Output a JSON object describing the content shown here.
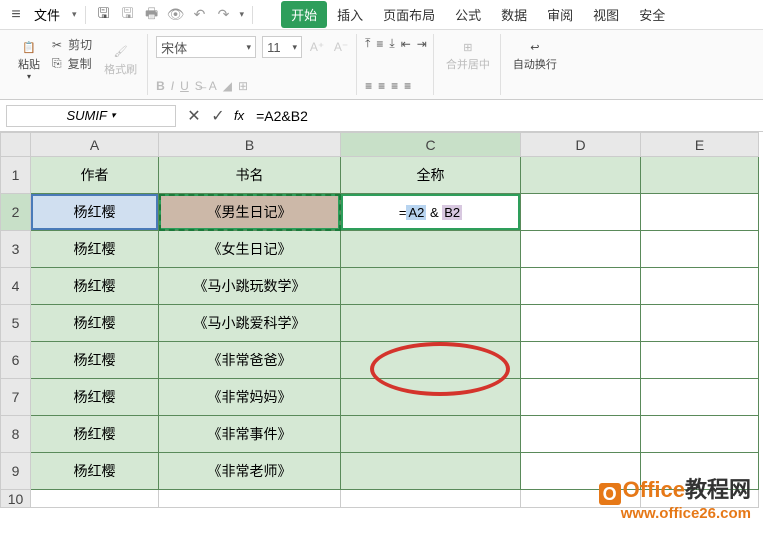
{
  "menu": {
    "file": "文件",
    "tabs": [
      "开始",
      "插入",
      "页面布局",
      "公式",
      "数据",
      "审阅",
      "视图",
      "安全"
    ]
  },
  "ribbon": {
    "paste": "粘贴",
    "cut": "剪切",
    "copy": "复制",
    "format_painter": "格式刷",
    "font_name": "宋体",
    "font_size": "11",
    "merge": "合并居中",
    "wrap": "自动换行"
  },
  "formula_bar": {
    "name_box": "SUMIF",
    "cancel": "✕",
    "confirm": "✓",
    "fx": "fx",
    "formula": "=A2&B2"
  },
  "columns": [
    "A",
    "B",
    "C",
    "D",
    "E"
  ],
  "rows": [
    "1",
    "2",
    "3",
    "4",
    "5",
    "6",
    "7",
    "8",
    "9",
    "10"
  ],
  "headers": {
    "a": "作者",
    "b": "书名",
    "c": "全称"
  },
  "cell_formula": {
    "eq": "=",
    "a2": "A2",
    "amp": " & ",
    "b2": "B2"
  },
  "data": [
    {
      "a": "杨红樱",
      "b": "《男生日记》"
    },
    {
      "a": "杨红樱",
      "b": "《女生日记》"
    },
    {
      "a": "杨红樱",
      "b": "《马小跳玩数学》"
    },
    {
      "a": "杨红樱",
      "b": "《马小跳爱科学》"
    },
    {
      "a": "杨红樱",
      "b": "《非常爸爸》"
    },
    {
      "a": "杨红樱",
      "b": "《非常妈妈》"
    },
    {
      "a": "杨红樱",
      "b": "《非常事件》"
    },
    {
      "a": "杨红樱",
      "b": "《非常老师》"
    }
  ],
  "watermark": {
    "brand_o": "O",
    "brand": "Office",
    "brand_cn": "教程网",
    "url": "www.office26.com"
  }
}
